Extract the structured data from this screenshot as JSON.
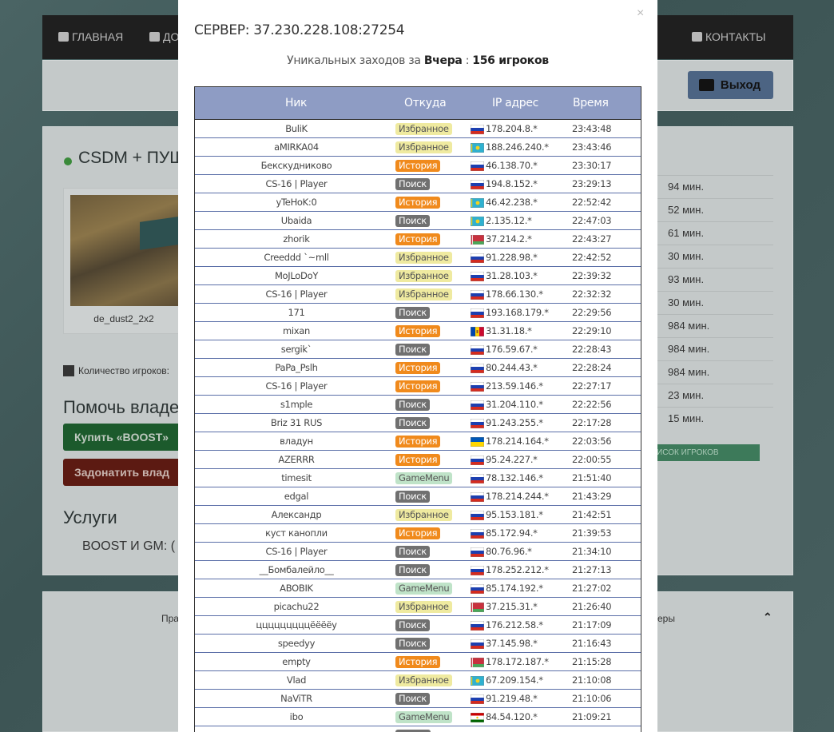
{
  "nav": {
    "items": [
      {
        "label": "ГЛАВНАЯ",
        "icon": "home-icon"
      },
      {
        "label": "ДО",
        "icon": "plus-square-icon"
      },
      {
        "label": "КОНТАКТЫ",
        "icon": "envelope-icon"
      }
    ]
  },
  "header": {
    "exit_label": "Выход",
    "exit_icon": "sign-out-icon"
  },
  "server": {
    "name": "CSDM + ПУШ",
    "status_color": "#3a8a3a",
    "map_name": "de_dust2_2x2",
    "players_label": "Количество игроков:",
    "help_title": "Помочь владел",
    "boost_button": "Купить «BOOST»",
    "donate_button": "Задонатить влад",
    "services_title": "Услуги",
    "boost_gm_label": "BOOST И GM:   ("
  },
  "right_panel": {
    "times": [
      "94 мин.",
      "52 мин.",
      "61 мин.",
      "30 мин.",
      "93 мин.",
      "30 мин.",
      "984 мин.",
      "984 мин.",
      "984 мин.",
      "23 мин.",
      "15 мин."
    ],
    "list_button": "ИСОК ИГРОКОВ"
  },
  "footer": {
    "left_text": "Пра",
    "right_text": "еры"
  },
  "modal": {
    "title": "СЕРВЕР: 37.230.228.108:27254",
    "close_icon": "×",
    "unique_prefix": "Уникальных заходов за",
    "unique_period": "Вчера",
    "unique_sep": ":",
    "unique_count": "156 игроков",
    "columns": [
      "Ник",
      "Откуда",
      "IP адрес",
      "Время"
    ],
    "rows": [
      {
        "nick": "BuliK",
        "source": "Избранное",
        "type": "fav",
        "flag": "ru",
        "ip": "178.204.8.*",
        "time": "23:43:48"
      },
      {
        "nick": "aMIRKA04",
        "source": "Избранное",
        "type": "fav",
        "flag": "kz",
        "ip": "188.246.240.*",
        "time": "23:43:46"
      },
      {
        "nick": "Бекскудниково",
        "source": "История",
        "type": "hist",
        "flag": "ru",
        "ip": "46.138.70.*",
        "time": "23:30:17"
      },
      {
        "nick": "CS-16 | Player",
        "source": "Поиск",
        "type": "search",
        "flag": "ru",
        "ip": "194.8.152.*",
        "time": "23:29:13"
      },
      {
        "nick": "yTeHoK:0",
        "source": "История",
        "type": "hist",
        "flag": "kz",
        "ip": "46.42.238.*",
        "time": "22:52:42"
      },
      {
        "nick": "Ubaida",
        "source": "Поиск",
        "type": "search",
        "flag": "kz",
        "ip": "2.135.12.*",
        "time": "22:47:03"
      },
      {
        "nick": "zhorik",
        "source": "История",
        "type": "hist",
        "flag": "by",
        "ip": "37.214.2.*",
        "time": "22:43:27"
      },
      {
        "nick": "Creeddd `~mll",
        "source": "Избранное",
        "type": "fav",
        "flag": "ru",
        "ip": "91.228.98.*",
        "time": "22:42:52"
      },
      {
        "nick": "MoJLoDoY",
        "source": "Избранное",
        "type": "fav",
        "flag": "ru",
        "ip": "31.28.103.*",
        "time": "22:39:32"
      },
      {
        "nick": "CS-16 | Player",
        "source": "Избранное",
        "type": "fav",
        "flag": "ru",
        "ip": "178.66.130.*",
        "time": "22:32:32"
      },
      {
        "nick": "171",
        "source": "Поиск",
        "type": "search",
        "flag": "ru",
        "ip": "193.168.179.*",
        "time": "22:29:56"
      },
      {
        "nick": "mixan",
        "source": "История",
        "type": "hist",
        "flag": "md",
        "ip": "31.31.18.*",
        "time": "22:29:10"
      },
      {
        "nick": "sergik`",
        "source": "Поиск",
        "type": "search",
        "flag": "ru",
        "ip": "176.59.67.*",
        "time": "22:28:43"
      },
      {
        "nick": "PaPa_Pslh",
        "source": "История",
        "type": "hist",
        "flag": "ru",
        "ip": "80.244.43.*",
        "time": "22:28:24"
      },
      {
        "nick": "CS-16 | Player",
        "source": "История",
        "type": "hist",
        "flag": "ru",
        "ip": "213.59.146.*",
        "time": "22:27:17"
      },
      {
        "nick": "s1mple",
        "source": "Поиск",
        "type": "search",
        "flag": "ru",
        "ip": "31.204.110.*",
        "time": "22:22:56"
      },
      {
        "nick": "Briz 31 RUS",
        "source": "Поиск",
        "type": "search",
        "flag": "ru",
        "ip": "91.243.255.*",
        "time": "22:17:28"
      },
      {
        "nick": "владун",
        "source": "История",
        "type": "hist",
        "flag": "ua",
        "ip": "178.214.164.*",
        "time": "22:03:56"
      },
      {
        "nick": "AZERRR",
        "source": "История",
        "type": "hist",
        "flag": "ru",
        "ip": "95.24.227.*",
        "time": "22:00:55"
      },
      {
        "nick": "timesit",
        "source": "GameMenu",
        "type": "gm",
        "flag": "ru",
        "ip": "78.132.146.*",
        "time": "21:51:40"
      },
      {
        "nick": "edgal",
        "source": "Поиск",
        "type": "search",
        "flag": "ru",
        "ip": "178.214.244.*",
        "time": "21:43:29"
      },
      {
        "nick": "Александр",
        "source": "Избранное",
        "type": "fav",
        "flag": "ru",
        "ip": "95.153.181.*",
        "time": "21:42:51"
      },
      {
        "nick": "куст канопли",
        "source": "История",
        "type": "hist",
        "flag": "ru",
        "ip": "85.172.94.*",
        "time": "21:39:53"
      },
      {
        "nick": "CS-16 | Player",
        "source": "Поиск",
        "type": "search",
        "flag": "ru",
        "ip": "80.76.96.*",
        "time": "21:34:10"
      },
      {
        "nick": "__Бомбалейло__",
        "source": "Поиск",
        "type": "search",
        "flag": "ru",
        "ip": "178.252.212.*",
        "time": "21:27:13"
      },
      {
        "nick": "ABOBIK",
        "source": "GameMenu",
        "type": "gm",
        "flag": "ru",
        "ip": "85.174.192.*",
        "time": "21:27:02"
      },
      {
        "nick": "picachu22",
        "source": "Избранное",
        "type": "fav",
        "flag": "by",
        "ip": "37.215.31.*",
        "time": "21:26:40"
      },
      {
        "nick": "цццццццццёёёёу",
        "source": "Поиск",
        "type": "search",
        "flag": "ru",
        "ip": "176.212.58.*",
        "time": "21:17:09"
      },
      {
        "nick": "speedyy",
        "source": "Поиск",
        "type": "search",
        "flag": "ru",
        "ip": "37.145.98.*",
        "time": "21:16:43"
      },
      {
        "nick": "empty",
        "source": "История",
        "type": "hist",
        "flag": "by",
        "ip": "178.172.187.*",
        "time": "21:15:28"
      },
      {
        "nick": "Vlad",
        "source": "Избранное",
        "type": "fav",
        "flag": "kz",
        "ip": "67.209.154.*",
        "time": "21:10:08"
      },
      {
        "nick": "NaViTR",
        "source": "Поиск",
        "type": "search",
        "flag": "ru",
        "ip": "91.219.48.*",
        "time": "21:10:06"
      },
      {
        "nick": "ibo",
        "source": "GameMenu",
        "type": "gm",
        "flag": "tj",
        "ip": "84.54.120.*",
        "time": "21:09:21"
      }
    ]
  }
}
